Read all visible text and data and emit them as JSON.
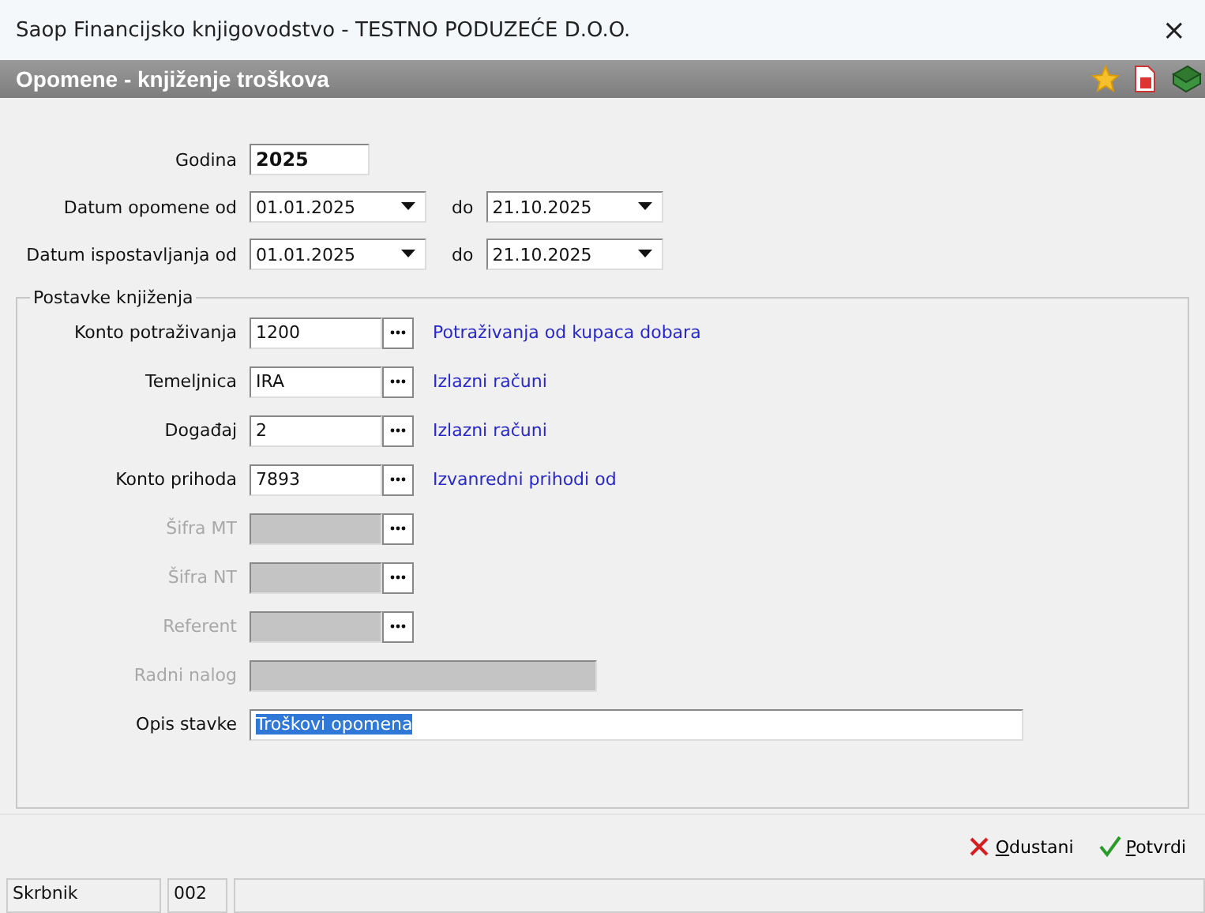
{
  "window": {
    "title": "Saop Financijsko knjigovodstvo - TESTNO PODUZEĆE D.O.O.",
    "close": "×"
  },
  "header": {
    "title": "Opomene - knjiženje troškova"
  },
  "year": {
    "label": "Godina",
    "value": "2025"
  },
  "date_rows": [
    {
      "label": "Datum opomene od",
      "from": "01.01.2025",
      "to_label": "do",
      "to": "21.10.2025"
    },
    {
      "label": "Datum ispostavljanja od",
      "from": "01.01.2025",
      "to_label": "do",
      "to": "21.10.2025"
    }
  ],
  "group": {
    "title": "Postavke knjiženja",
    "rows": [
      {
        "kind": "lookup",
        "label": "Konto potraživanja",
        "value": "1200",
        "description": "Potraživanja od kupaca dobara",
        "disabled": false
      },
      {
        "kind": "lookup",
        "label": "Temeljnica",
        "value": "IRA",
        "description": "Izlazni računi",
        "disabled": false
      },
      {
        "kind": "lookup",
        "label": "Događaj",
        "value": "2",
        "description": "Izlazni računi",
        "disabled": false
      },
      {
        "kind": "lookup",
        "label": "Konto prihoda",
        "value": "7893",
        "description": "Izvanredni prihodi od",
        "disabled": false
      },
      {
        "kind": "lookup",
        "label": "Šifra MT",
        "disabled": true
      },
      {
        "kind": "lookup",
        "label": "Šifra NT",
        "disabled": true
      },
      {
        "kind": "lookup",
        "label": "Referent",
        "disabled": true
      },
      {
        "kind": "text",
        "label": "Radni nalog",
        "disabled": true
      },
      {
        "kind": "wide",
        "label": "Opis stavke",
        "value": "Troškovi opomena",
        "disabled": false,
        "selected": true
      }
    ]
  },
  "buttons": [
    {
      "kind": "cancel",
      "label": "Odustani"
    },
    {
      "kind": "confirm",
      "label": "Potvrdi"
    }
  ],
  "status_bar": [
    "Skrbnik",
    "002"
  ]
}
